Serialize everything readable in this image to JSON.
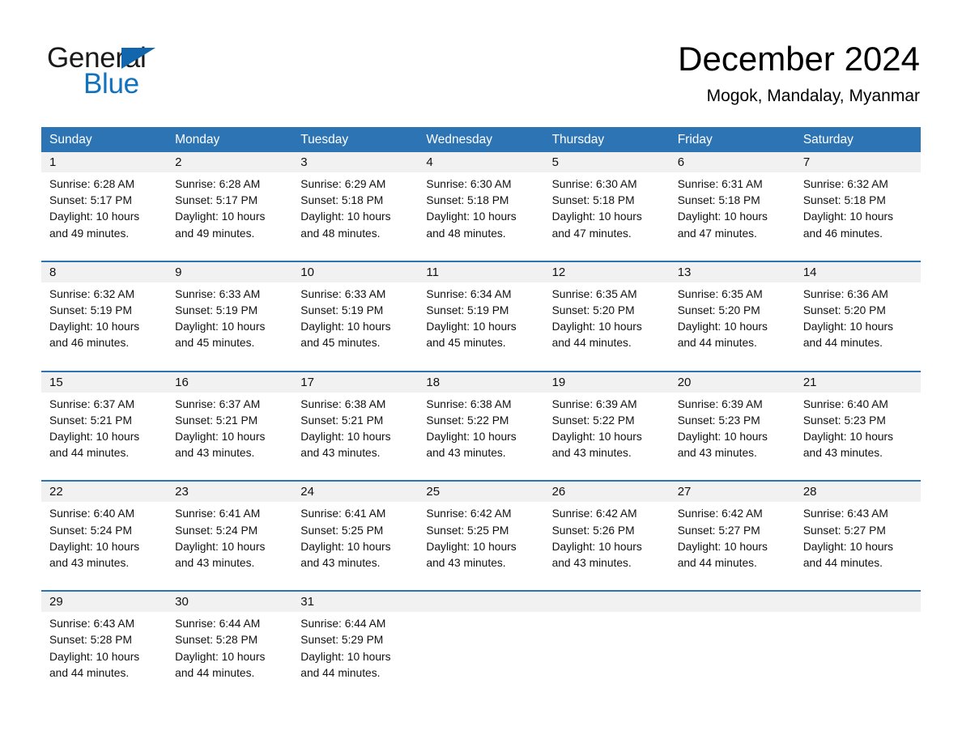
{
  "logo": {
    "word_one": "General",
    "word_two": "Blue",
    "triangle_color": "#1266ad",
    "blue_color": "#1272bd"
  },
  "header": {
    "title": "December 2024",
    "subtitle": "Mogok, Mandalay, Myanmar"
  },
  "theme": {
    "header_blue": "#2d74b5",
    "daynum_band": "#f1f1f1",
    "row_rule": "#2d74b5"
  },
  "weekdays": [
    "Sunday",
    "Monday",
    "Tuesday",
    "Wednesday",
    "Thursday",
    "Friday",
    "Saturday"
  ],
  "weeks": [
    {
      "days": [
        {
          "num": "1",
          "sunrise": "Sunrise: 6:28 AM",
          "sunset": "Sunset: 5:17 PM",
          "daylight": "Daylight: 10 hours and 49 minutes."
        },
        {
          "num": "2",
          "sunrise": "Sunrise: 6:28 AM",
          "sunset": "Sunset: 5:17 PM",
          "daylight": "Daylight: 10 hours and 49 minutes."
        },
        {
          "num": "3",
          "sunrise": "Sunrise: 6:29 AM",
          "sunset": "Sunset: 5:18 PM",
          "daylight": "Daylight: 10 hours and 48 minutes."
        },
        {
          "num": "4",
          "sunrise": "Sunrise: 6:30 AM",
          "sunset": "Sunset: 5:18 PM",
          "daylight": "Daylight: 10 hours and 48 minutes."
        },
        {
          "num": "5",
          "sunrise": "Sunrise: 6:30 AM",
          "sunset": "Sunset: 5:18 PM",
          "daylight": "Daylight: 10 hours and 47 minutes."
        },
        {
          "num": "6",
          "sunrise": "Sunrise: 6:31 AM",
          "sunset": "Sunset: 5:18 PM",
          "daylight": "Daylight: 10 hours and 47 minutes."
        },
        {
          "num": "7",
          "sunrise": "Sunrise: 6:32 AM",
          "sunset": "Sunset: 5:18 PM",
          "daylight": "Daylight: 10 hours and 46 minutes."
        }
      ]
    },
    {
      "days": [
        {
          "num": "8",
          "sunrise": "Sunrise: 6:32 AM",
          "sunset": "Sunset: 5:19 PM",
          "daylight": "Daylight: 10 hours and 46 minutes."
        },
        {
          "num": "9",
          "sunrise": "Sunrise: 6:33 AM",
          "sunset": "Sunset: 5:19 PM",
          "daylight": "Daylight: 10 hours and 45 minutes."
        },
        {
          "num": "10",
          "sunrise": "Sunrise: 6:33 AM",
          "sunset": "Sunset: 5:19 PM",
          "daylight": "Daylight: 10 hours and 45 minutes."
        },
        {
          "num": "11",
          "sunrise": "Sunrise: 6:34 AM",
          "sunset": "Sunset: 5:19 PM",
          "daylight": "Daylight: 10 hours and 45 minutes."
        },
        {
          "num": "12",
          "sunrise": "Sunrise: 6:35 AM",
          "sunset": "Sunset: 5:20 PM",
          "daylight": "Daylight: 10 hours and 44 minutes."
        },
        {
          "num": "13",
          "sunrise": "Sunrise: 6:35 AM",
          "sunset": "Sunset: 5:20 PM",
          "daylight": "Daylight: 10 hours and 44 minutes."
        },
        {
          "num": "14",
          "sunrise": "Sunrise: 6:36 AM",
          "sunset": "Sunset: 5:20 PM",
          "daylight": "Daylight: 10 hours and 44 minutes."
        }
      ]
    },
    {
      "days": [
        {
          "num": "15",
          "sunrise": "Sunrise: 6:37 AM",
          "sunset": "Sunset: 5:21 PM",
          "daylight": "Daylight: 10 hours and 44 minutes."
        },
        {
          "num": "16",
          "sunrise": "Sunrise: 6:37 AM",
          "sunset": "Sunset: 5:21 PM",
          "daylight": "Daylight: 10 hours and 43 minutes."
        },
        {
          "num": "17",
          "sunrise": "Sunrise: 6:38 AM",
          "sunset": "Sunset: 5:21 PM",
          "daylight": "Daylight: 10 hours and 43 minutes."
        },
        {
          "num": "18",
          "sunrise": "Sunrise: 6:38 AM",
          "sunset": "Sunset: 5:22 PM",
          "daylight": "Daylight: 10 hours and 43 minutes."
        },
        {
          "num": "19",
          "sunrise": "Sunrise: 6:39 AM",
          "sunset": "Sunset: 5:22 PM",
          "daylight": "Daylight: 10 hours and 43 minutes."
        },
        {
          "num": "20",
          "sunrise": "Sunrise: 6:39 AM",
          "sunset": "Sunset: 5:23 PM",
          "daylight": "Daylight: 10 hours and 43 minutes."
        },
        {
          "num": "21",
          "sunrise": "Sunrise: 6:40 AM",
          "sunset": "Sunset: 5:23 PM",
          "daylight": "Daylight: 10 hours and 43 minutes."
        }
      ]
    },
    {
      "days": [
        {
          "num": "22",
          "sunrise": "Sunrise: 6:40 AM",
          "sunset": "Sunset: 5:24 PM",
          "daylight": "Daylight: 10 hours and 43 minutes."
        },
        {
          "num": "23",
          "sunrise": "Sunrise: 6:41 AM",
          "sunset": "Sunset: 5:24 PM",
          "daylight": "Daylight: 10 hours and 43 minutes."
        },
        {
          "num": "24",
          "sunrise": "Sunrise: 6:41 AM",
          "sunset": "Sunset: 5:25 PM",
          "daylight": "Daylight: 10 hours and 43 minutes."
        },
        {
          "num": "25",
          "sunrise": "Sunrise: 6:42 AM",
          "sunset": "Sunset: 5:25 PM",
          "daylight": "Daylight: 10 hours and 43 minutes."
        },
        {
          "num": "26",
          "sunrise": "Sunrise: 6:42 AM",
          "sunset": "Sunset: 5:26 PM",
          "daylight": "Daylight: 10 hours and 43 minutes."
        },
        {
          "num": "27",
          "sunrise": "Sunrise: 6:42 AM",
          "sunset": "Sunset: 5:27 PM",
          "daylight": "Daylight: 10 hours and 44 minutes."
        },
        {
          "num": "28",
          "sunrise": "Sunrise: 6:43 AM",
          "sunset": "Sunset: 5:27 PM",
          "daylight": "Daylight: 10 hours and 44 minutes."
        }
      ]
    },
    {
      "days": [
        {
          "num": "29",
          "sunrise": "Sunrise: 6:43 AM",
          "sunset": "Sunset: 5:28 PM",
          "daylight": "Daylight: 10 hours and 44 minutes."
        },
        {
          "num": "30",
          "sunrise": "Sunrise: 6:44 AM",
          "sunset": "Sunset: 5:28 PM",
          "daylight": "Daylight: 10 hours and 44 minutes."
        },
        {
          "num": "31",
          "sunrise": "Sunrise: 6:44 AM",
          "sunset": "Sunset: 5:29 PM",
          "daylight": "Daylight: 10 hours and 44 minutes."
        },
        {
          "num": "",
          "sunrise": "",
          "sunset": "",
          "daylight": ""
        },
        {
          "num": "",
          "sunrise": "",
          "sunset": "",
          "daylight": ""
        },
        {
          "num": "",
          "sunrise": "",
          "sunset": "",
          "daylight": ""
        },
        {
          "num": "",
          "sunrise": "",
          "sunset": "",
          "daylight": ""
        }
      ]
    }
  ]
}
